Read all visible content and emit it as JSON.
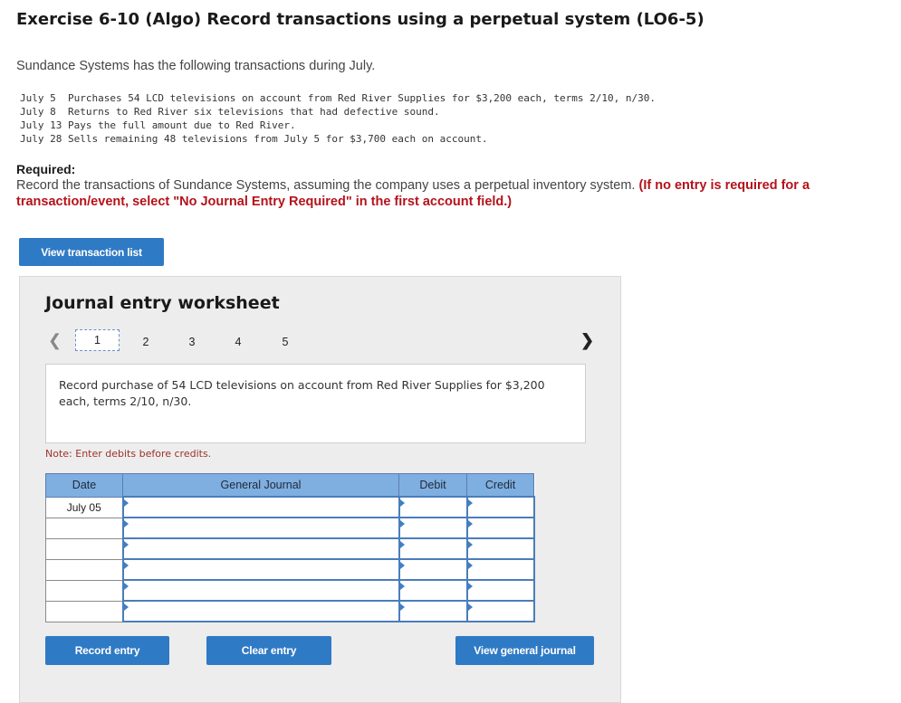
{
  "header": {
    "title": "Exercise 6-10 (Algo) Record transactions using a perpetual system (LO6-5)"
  },
  "intro": "Sundance Systems has the following transactions during July.",
  "transactions": [
    {
      "date": "July 5 ",
      "text": "Purchases 54 LCD televisions on account from Red River Supplies for $3,200 each, terms 2/10, n/30."
    },
    {
      "date": "July 8 ",
      "text": "Returns to Red River six televisions that had defective sound."
    },
    {
      "date": "July 13",
      "text": "Pays the full amount due to Red River."
    },
    {
      "date": "July 28",
      "text": "Sells remaining 48 televisions from July 5 for $3,700 each on account."
    }
  ],
  "required": {
    "heading": "Required:",
    "text": "Record the transactions of Sundance Systems, assuming the company uses a perpetual inventory system. ",
    "instruction": "(If no entry is required for a transaction/event, select \"No Journal Entry Required\" in the first account field.)"
  },
  "buttons": {
    "view_list": "View transaction list",
    "record": "Record entry",
    "clear": "Clear entry",
    "view_journal": "View general journal"
  },
  "worksheet": {
    "title": "Journal entry worksheet",
    "pages": [
      "1",
      "2",
      "3",
      "4",
      "5"
    ],
    "active_page": "1",
    "description": "Record purchase of 54 LCD televisions on account from Red River Supplies for $3,200 each, terms 2/10, n/30.",
    "note": "Note: Enter debits before credits."
  },
  "journal": {
    "headers": [
      "Date",
      "General Journal",
      "Debit",
      "Credit"
    ],
    "rows": [
      {
        "date": "July 05",
        "account": "",
        "debit": "",
        "credit": ""
      },
      {
        "date": "",
        "account": "",
        "debit": "",
        "credit": ""
      },
      {
        "date": "",
        "account": "",
        "debit": "",
        "credit": ""
      },
      {
        "date": "",
        "account": "",
        "debit": "",
        "credit": ""
      },
      {
        "date": "",
        "account": "",
        "debit": "",
        "credit": ""
      },
      {
        "date": "",
        "account": "",
        "debit": "",
        "credit": ""
      }
    ]
  },
  "colors": {
    "button": "#2f7ac4",
    "header_fill": "#7faee0",
    "instruction_red": "#b5121b"
  },
  "icons": {
    "prev": "chevron-left-icon",
    "next": "chevron-right-icon"
  }
}
